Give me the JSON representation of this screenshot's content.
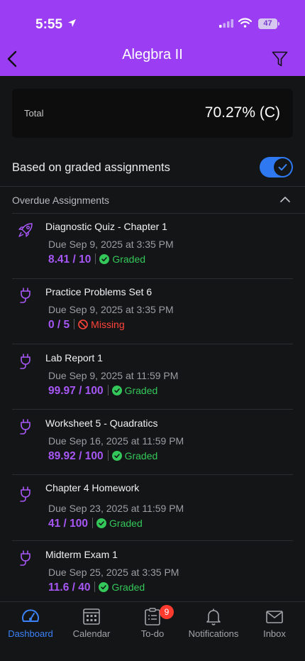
{
  "status_bar": {
    "time": "5:55",
    "battery": "47"
  },
  "header": {
    "title": "Alegbra II"
  },
  "total": {
    "label": "Total",
    "value": "70.27% (C)"
  },
  "graded_toggle": {
    "label": "Based on graded assignments",
    "on": true
  },
  "section": {
    "title": "Overdue Assignments"
  },
  "assignments": [
    {
      "icon": "rocket-icon",
      "title": "Diagnostic Quiz - Chapter 1",
      "due": "Due Sep 9, 2025 at 3:35 PM",
      "score": "8.41 / 10",
      "status": "Graded"
    },
    {
      "icon": "plug-icon",
      "title": "Practice Problems Set 6",
      "due": "Due Sep 9, 2025 at 3:35 PM",
      "score": "0 / 5",
      "status": "Missing"
    },
    {
      "icon": "plug-icon",
      "title": "Lab Report 1",
      "due": "Due Sep 9, 2025 at 11:59 PM",
      "score": "99.97 / 100",
      "status": "Graded"
    },
    {
      "icon": "plug-icon",
      "title": "Worksheet 5 - Quadratics",
      "due": "Due Sep 16, 2025 at 11:59 PM",
      "score": "89.92 / 100",
      "status": "Graded"
    },
    {
      "icon": "plug-icon",
      "title": "Chapter 4 Homework",
      "due": "Due Sep 23, 2025 at 11:59 PM",
      "score": "41 / 100",
      "status": "Graded"
    },
    {
      "icon": "plug-icon",
      "title": "Midterm Exam 1",
      "due": "Due Sep 25, 2025 at 3:35 PM",
      "score": "11.6 / 40",
      "status": "Graded"
    }
  ],
  "tabs": [
    {
      "label": "Dashboard",
      "icon": "gauge-icon",
      "active": true
    },
    {
      "label": "Calendar",
      "icon": "calendar-icon"
    },
    {
      "label": "To-do",
      "icon": "clipboard-icon",
      "badge": "9"
    },
    {
      "label": "Notifications",
      "icon": "bell-icon"
    },
    {
      "label": "Inbox",
      "icon": "envelope-icon"
    }
  ],
  "colors": {
    "header": "#9b3df2",
    "accent": "#a657f5",
    "graded": "#34c759",
    "missing": "#ff453a",
    "toggle": "#2e79f2",
    "active_tab": "#3b82f6"
  }
}
